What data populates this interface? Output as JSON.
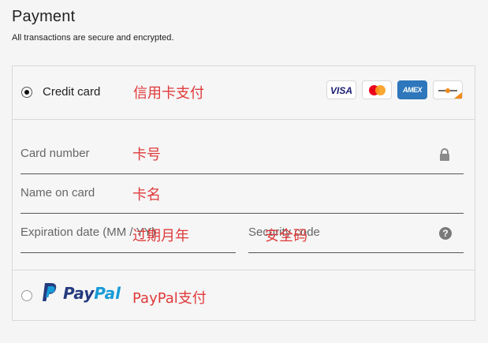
{
  "header": {
    "title": "Payment",
    "subtitle": "All transactions are secure and encrypted."
  },
  "credit_card": {
    "label": "Credit card",
    "selected": true,
    "annotation": "信用卡支付",
    "logos": [
      "visa",
      "mastercard",
      "amex",
      "discover"
    ],
    "visa_text": "VISA",
    "amex_text": "AMEX"
  },
  "fields": {
    "card_number": {
      "placeholder": "Card number",
      "annotation": "卡号",
      "icon": "lock-icon"
    },
    "name_on_card": {
      "placeholder": "Name on card",
      "annotation": "卡名"
    },
    "expiration": {
      "placeholder": "Expiration date (MM / YY)",
      "annotation": "过期月年"
    },
    "security_code": {
      "placeholder": "Security code",
      "annotation": "安全码",
      "icon": "help-icon",
      "help_glyph": "?"
    }
  },
  "paypal": {
    "label_pay": "Pay",
    "label_pal": "Pal",
    "selected": false,
    "annotation": "PayPal支付"
  },
  "colors": {
    "annotation": "#e03a3a",
    "paypal_dark": "#253b80",
    "paypal_light": "#179bd7",
    "amex": "#2e77bc"
  }
}
